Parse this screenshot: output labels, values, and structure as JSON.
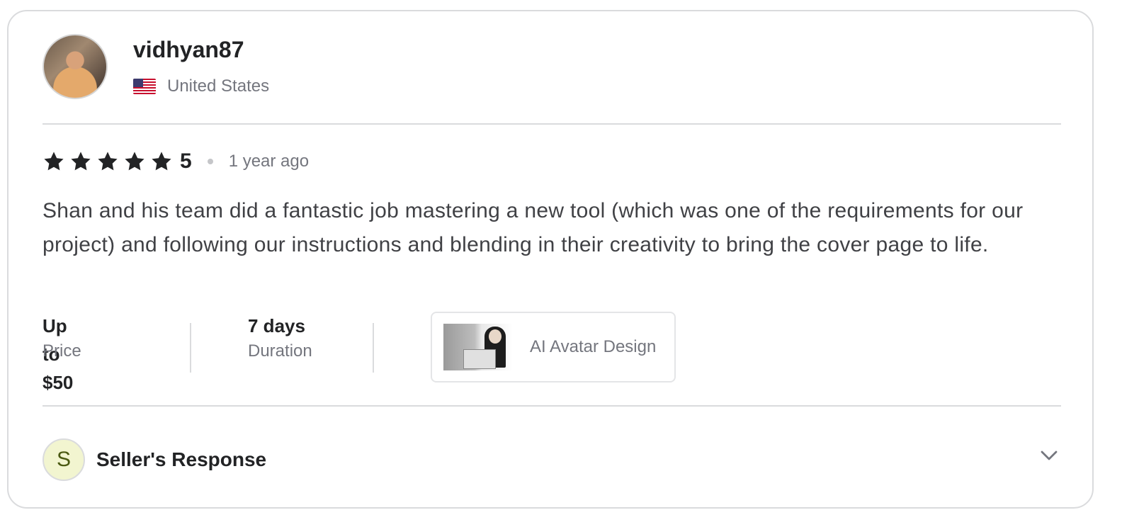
{
  "reviewer": {
    "username": "vidhyan87",
    "country": "United States"
  },
  "review": {
    "rating": "5",
    "stars": 5,
    "time_ago": "1 year ago",
    "text": "Shan and his team did a fantastic job mastering a new tool (which was one of the requirements for our project) and following our instructions and blending in their creativity to bring the cover page to life."
  },
  "meta": {
    "price_value": "Up to $50",
    "price_label": "Price",
    "duration_value": "7 days",
    "duration_label": "Duration",
    "gig_title": "AI Avatar Design"
  },
  "seller_response": {
    "initial": "S",
    "label": "Seller's Response"
  },
  "colors": {
    "text_primary": "#222325",
    "text_secondary": "#74767e",
    "border": "#dadbdd",
    "seller_avatar_bg": "#f2f5d0"
  },
  "icons": [
    "us-flag-icon",
    "star-icon",
    "chevron-down-icon"
  ]
}
